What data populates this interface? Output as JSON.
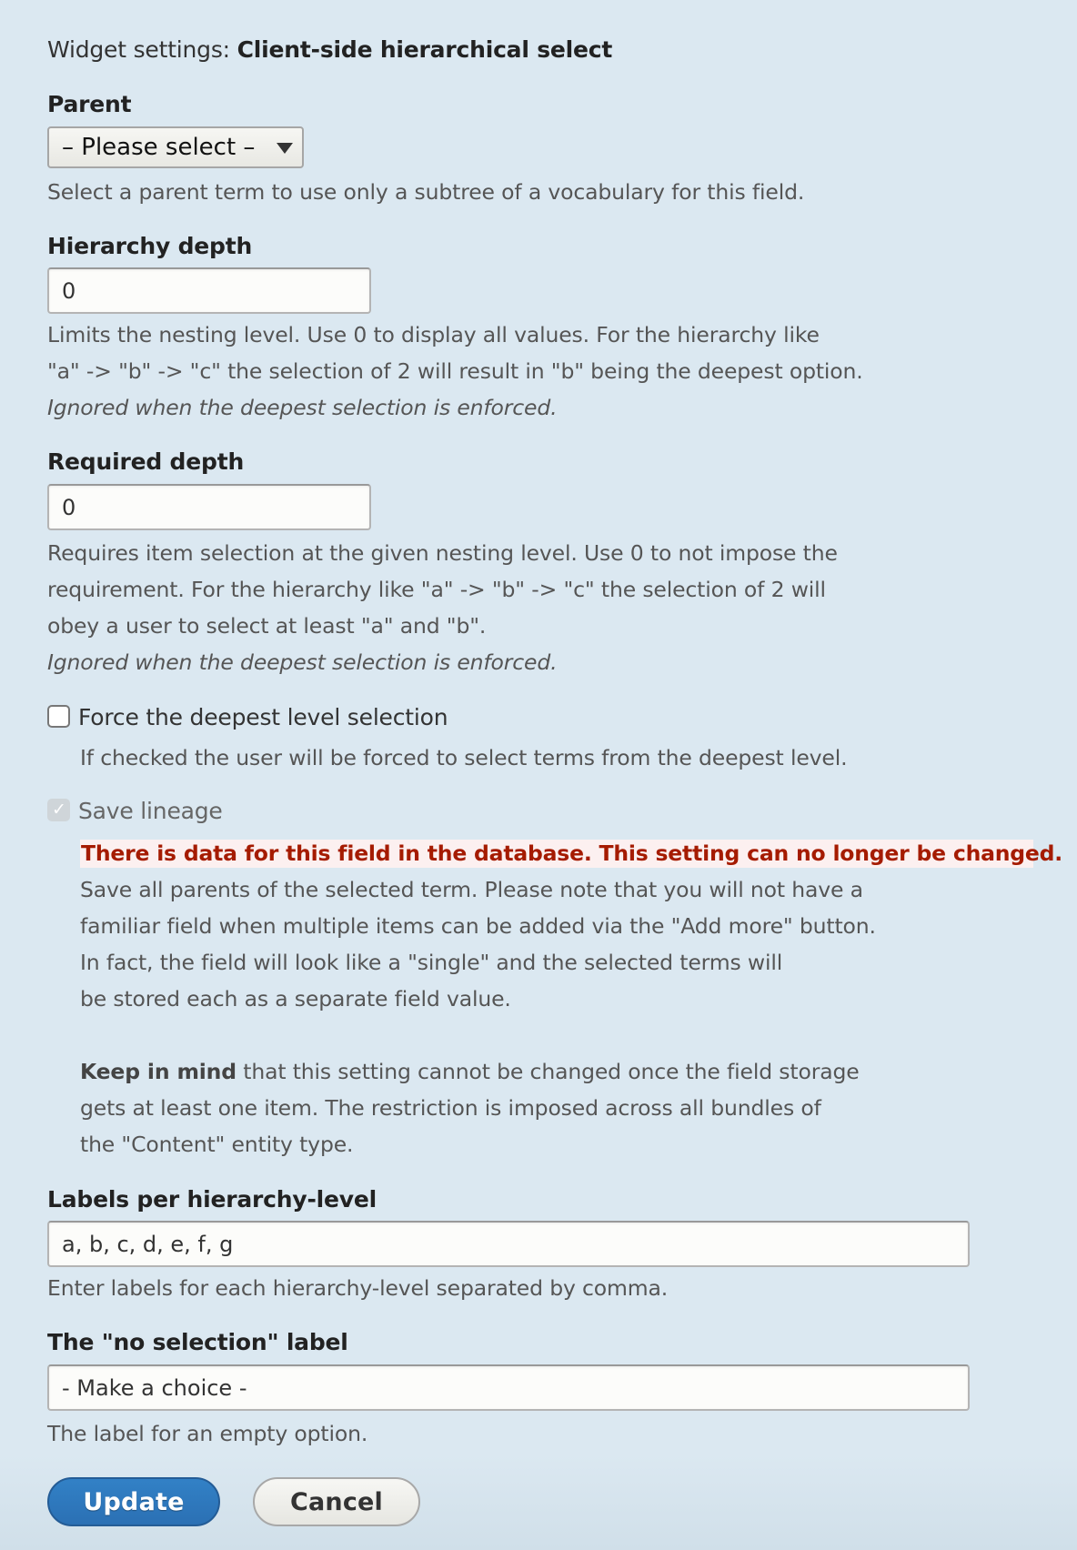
{
  "header": {
    "prefix": "Widget settings:",
    "widget_name": "Client-side hierarchical select"
  },
  "parent": {
    "label": "Parent",
    "selected": "– Please select –",
    "description": "Select a parent term to use only a subtree of a vocabulary for this field."
  },
  "hierarchy_depth": {
    "label": "Hierarchy depth",
    "value": "0",
    "description_lines": [
      "Limits the nesting level. Use 0 to display all values. For the hierarchy like",
      "\"a\" -> \"b\" -> \"c\" the selection of 2 will result in \"b\" being the deepest option."
    ],
    "note": "Ignored when the deepest selection is enforced."
  },
  "required_depth": {
    "label": "Required depth",
    "value": "0",
    "description_lines": [
      "Requires item selection at the given nesting level. Use 0 to not impose the",
      "requirement. For the hierarchy like \"a\" -> \"b\" -> \"c\" the selection of 2 will",
      "obey a user to select at least \"a\" and \"b\"."
    ],
    "note": "Ignored when the deepest selection is enforced."
  },
  "force_deepest": {
    "label": "Force the deepest level selection",
    "checked": false,
    "description": "If checked the user will be forced to select terms from the deepest level."
  },
  "save_lineage": {
    "label": "Save lineage",
    "checked": true,
    "disabled": true,
    "warning": "There is data for this field in the database. This setting can no longer be changed.",
    "description_lines": [
      "Save all parents of the selected term. Please note that you will not have a",
      "familiar field when multiple items can be added via the \"Add more\" button.",
      "In fact, the field will look like a \"single\" and the selected terms will",
      "be stored each as a separate field value."
    ],
    "keep_in_mind_bold": "Keep in mind",
    "keep_in_mind_lines": [
      " that this setting cannot be changed once the field storage",
      "gets at least one item. The restriction is imposed across all bundles of",
      "the \"Content\" entity type."
    ]
  },
  "labels_per_level": {
    "label": "Labels per hierarchy-level",
    "value": "a, b, c, d, e, f, g",
    "description": "Enter labels for each hierarchy-level separated by comma."
  },
  "no_selection_label": {
    "label": "The \"no selection\" label",
    "value": "- Make a choice -",
    "description": "The label for an empty option."
  },
  "actions": {
    "update_label": "Update",
    "cancel_label": "Cancel"
  },
  "colors": {
    "background": "#dbe8f1",
    "primary_button": "#2f79bf",
    "warning_text": "#a51b00",
    "warning_bg": "#fcf0f0"
  }
}
